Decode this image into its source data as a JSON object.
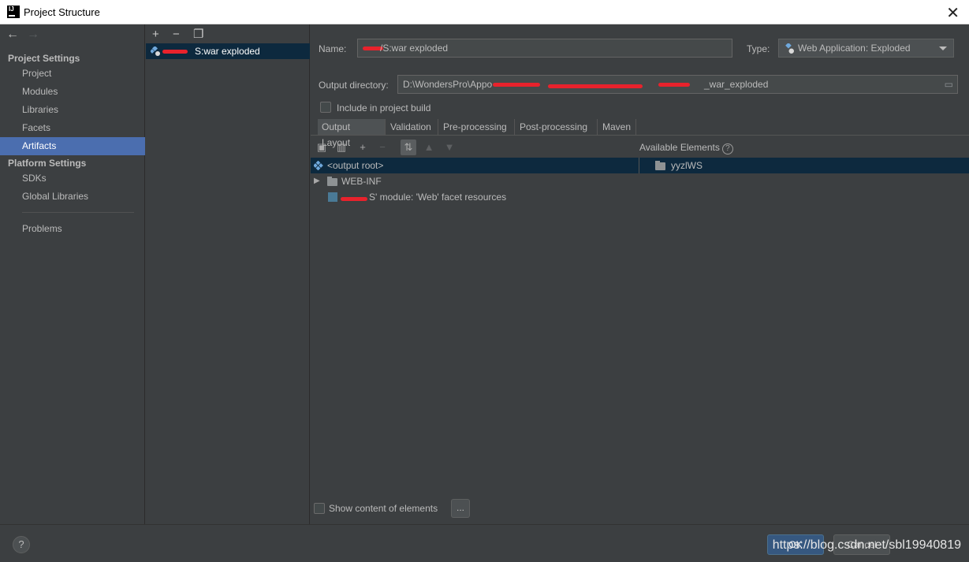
{
  "window": {
    "title": "Project Structure"
  },
  "sidebar": {
    "groups": [
      {
        "title": "Project Settings",
        "items": [
          "Project",
          "Modules",
          "Libraries",
          "Facets",
          "Artifacts"
        ]
      },
      {
        "title": "Platform Settings",
        "items": [
          "SDKs",
          "Global Libraries"
        ]
      }
    ],
    "extra_item": "Problems",
    "selected": "Artifacts"
  },
  "artifacts": {
    "list": [
      {
        "label": "S:war exploded"
      }
    ]
  },
  "form": {
    "name_label": "Name:",
    "name_value": "/S:war exploded",
    "type_label": "Type:",
    "type_value": "Web Application: Exploded",
    "output_dir_label": "Output directory:",
    "output_dir_value_start": "D:\\WondersPro\\Appo",
    "output_dir_value_end": "_war_exploded",
    "include_build_label": "Include in project build",
    "include_build_checked": false
  },
  "tabs": [
    "Output Layout",
    "Validation",
    "Pre-processing",
    "Post-processing",
    "Maven"
  ],
  "active_tab": "Output Layout",
  "layout": {
    "available_label": "Available Elements",
    "tree": [
      {
        "label": "<output root>",
        "selected": true
      },
      {
        "label": "WEB-INF",
        "expandable": true
      },
      {
        "label": "S' module: 'Web' facet resources"
      }
    ],
    "available_tree": [
      {
        "label": "yyzlWS"
      }
    ]
  },
  "show_content_label": "Show content of elements",
  "more_button_label": "...",
  "footer": {
    "help_label": "?",
    "ok_label": "OK",
    "cancel_label": "Cancel",
    "watermark": "https://blog.csdn.net/sbl19940819"
  },
  "colors": {
    "selection": "#4b6eaf",
    "tree_selection": "#0d293e",
    "background": "#3c3f41",
    "redaction": "#e8222c"
  }
}
